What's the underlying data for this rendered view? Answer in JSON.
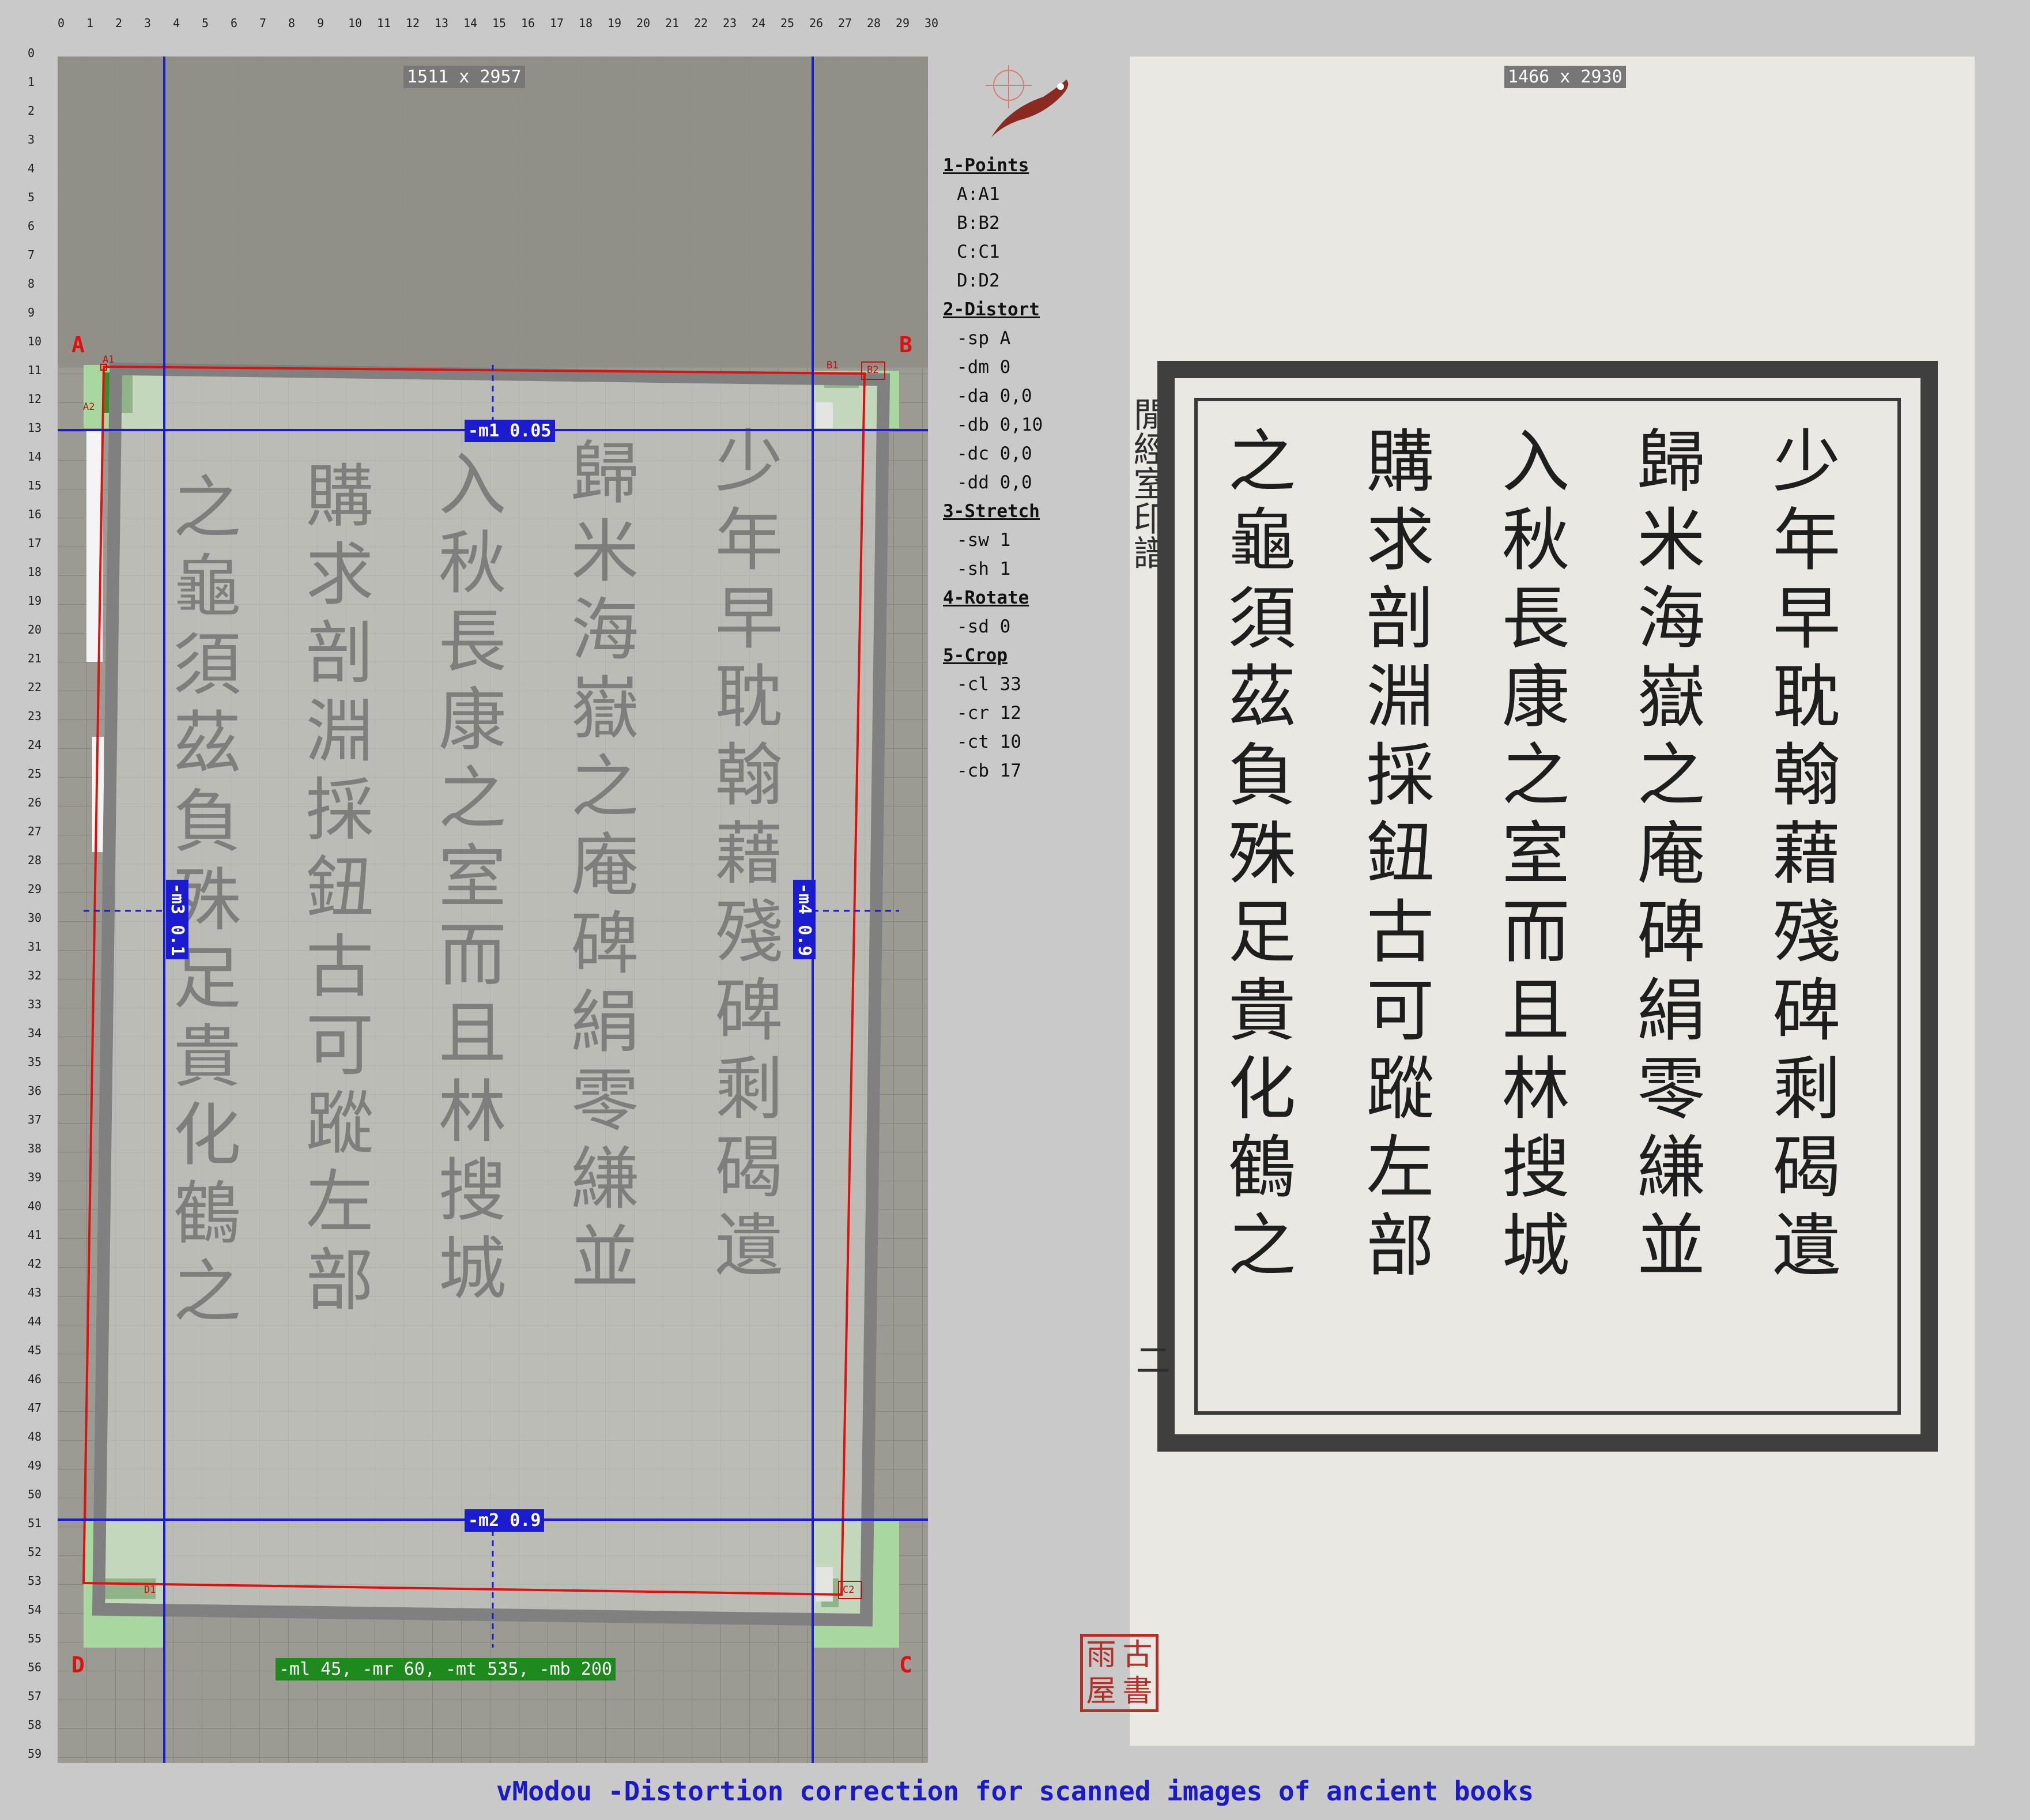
{
  "ruler": {
    "x": [
      "0",
      "1",
      "2",
      "3",
      "4",
      "5",
      "6",
      "7",
      "8",
      "9",
      "10",
      "11",
      "12",
      "13",
      "14",
      "15",
      "16",
      "17",
      "18",
      "19",
      "20",
      "21",
      "22",
      "23",
      "24",
      "25",
      "26",
      "27",
      "28",
      "29",
      "30"
    ],
    "y": [
      "0",
      "1",
      "2",
      "3",
      "4",
      "5",
      "6",
      "7",
      "8",
      "9",
      "10",
      "11",
      "12",
      "13",
      "14",
      "15",
      "16",
      "17",
      "18",
      "19",
      "20",
      "21",
      "22",
      "23",
      "24",
      "25",
      "26",
      "27",
      "28",
      "29",
      "30",
      "31",
      "32",
      "33",
      "34",
      "35",
      "36",
      "37",
      "38",
      "39",
      "40",
      "41",
      "42",
      "43",
      "44",
      "45",
      "46",
      "47",
      "48",
      "49",
      "50",
      "51",
      "52",
      "53",
      "54",
      "55",
      "56",
      "57",
      "58",
      "59"
    ]
  },
  "left_panel": {
    "size_label": "1511 x 2957",
    "corners": {
      "a": "A",
      "b": "B",
      "c": "C",
      "d": "D"
    },
    "small_points": {
      "a1": "A1",
      "a2": "A2",
      "b1": "B1",
      "b2": "B2",
      "c2": "C2",
      "d1": "D1"
    },
    "margins": {
      "m1": "-m1 0.05",
      "m2": "-m2 0.9",
      "m3": "-m3 0.1",
      "m4": "-m4 0.9"
    },
    "summary": "-ml 45, -mr 60, -mt 535, -mb 200"
  },
  "menu": {
    "sections": [
      {
        "title": "1-Points",
        "items": [
          "A:A1",
          "B:B2",
          "C:C1",
          "D:D2"
        ]
      },
      {
        "title": "2-Distort",
        "items": [
          "-sp A",
          "-dm 0",
          "-da 0,0",
          "-db 0,10",
          "-dc 0,0",
          "-dd 0,0"
        ]
      },
      {
        "title": "3-Stretch",
        "items": [
          "-sw 1",
          "-sh 1"
        ]
      },
      {
        "title": "4-Rotate",
        "items": [
          "-sd 0"
        ]
      },
      {
        "title": "5-Crop",
        "items": [
          "-cl 33",
          "-cr 12",
          "-ct 10",
          "-cb 17"
        ]
      }
    ]
  },
  "right_panel": {
    "size_label": "1466 x 2930",
    "side_note": "閒經室印譜",
    "columns": [
      "少年早耽翰藉殘碑剩碣遺",
      "歸米海嶽之庵碑絹零縑並",
      "入秋長康之室而且林搜城",
      "購求剖淵採鈕古可蹤左部",
      "之龜須茲負殊足貴化鶴之"
    ],
    "page_mark": "二",
    "seal": [
      "古",
      "雨",
      "書",
      "屋"
    ]
  },
  "footer": {
    "title": "vModou -Distortion correction for scanned images of ancient books"
  },
  "colors": {
    "bg": "#c9c9c9",
    "guide_blue": "#1b1bd0",
    "crop_red": "#e01010",
    "margin_green": "#1e8a1e",
    "seal_red": "#b0302a"
  }
}
